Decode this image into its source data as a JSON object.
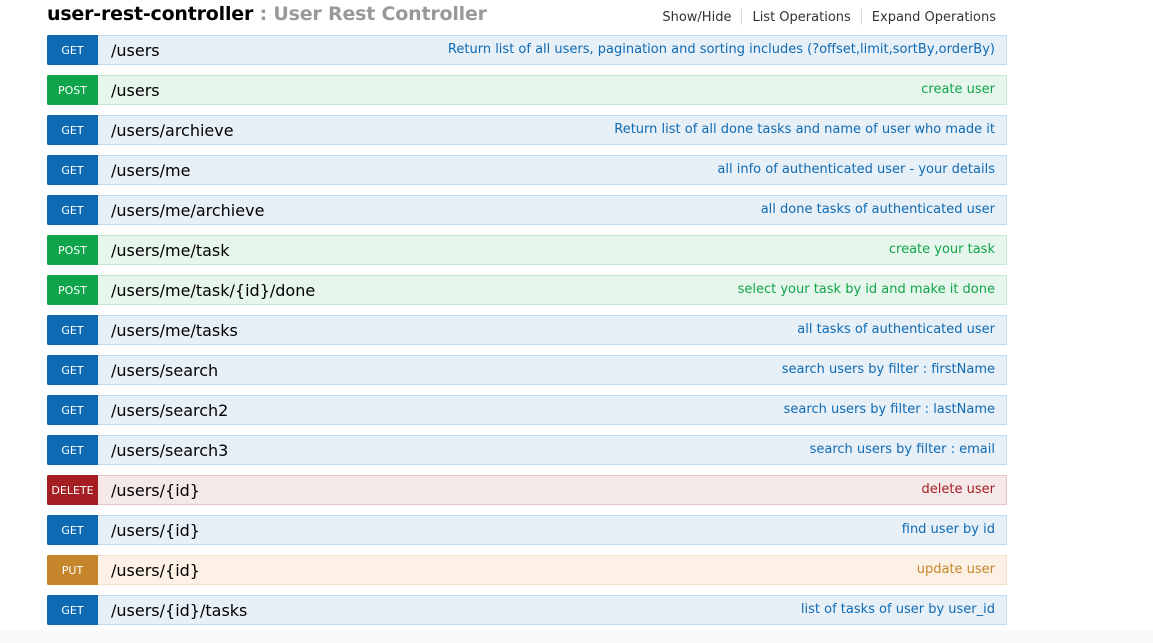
{
  "header": {
    "controller_name": "user-rest-controller",
    "separator": ":",
    "controller_title": "User Rest Controller",
    "links": {
      "show_hide": "Show/Hide",
      "list_operations": "List Operations",
      "expand_operations": "Expand Operations"
    }
  },
  "colors": {
    "get": "#0f6ab4",
    "post": "#10a54a",
    "delete": "#a41e22",
    "put": "#c5862b"
  },
  "operations": [
    {
      "method": "GET",
      "path": "/users",
      "summary": "Return list of all users, pagination and sorting includes (?offset,limit,sortBy,orderBy)"
    },
    {
      "method": "POST",
      "path": "/users",
      "summary": "create user"
    },
    {
      "method": "GET",
      "path": "/users/archieve",
      "summary": "Return list of all done tasks and name of user who made it"
    },
    {
      "method": "GET",
      "path": "/users/me",
      "summary": "all info of authenticated user - your details"
    },
    {
      "method": "GET",
      "path": "/users/me/archieve",
      "summary": "all done tasks of authenticated user"
    },
    {
      "method": "POST",
      "path": "/users/me/task",
      "summary": "create your task"
    },
    {
      "method": "POST",
      "path": "/users/me/task/{id}/done",
      "summary": "select your task by id and make it done"
    },
    {
      "method": "GET",
      "path": "/users/me/tasks",
      "summary": "all tasks of authenticated user"
    },
    {
      "method": "GET",
      "path": "/users/search",
      "summary": "search users by filter : firstName"
    },
    {
      "method": "GET",
      "path": "/users/search2",
      "summary": "search users by filter : lastName"
    },
    {
      "method": "GET",
      "path": "/users/search3",
      "summary": "search users by filter : email"
    },
    {
      "method": "DELETE",
      "path": "/users/{id}",
      "summary": "delete user"
    },
    {
      "method": "GET",
      "path": "/users/{id}",
      "summary": "find user by id"
    },
    {
      "method": "PUT",
      "path": "/users/{id}",
      "summary": "update user"
    },
    {
      "method": "GET",
      "path": "/users/{id}/tasks",
      "summary": "list of tasks of user by user_id"
    }
  ]
}
